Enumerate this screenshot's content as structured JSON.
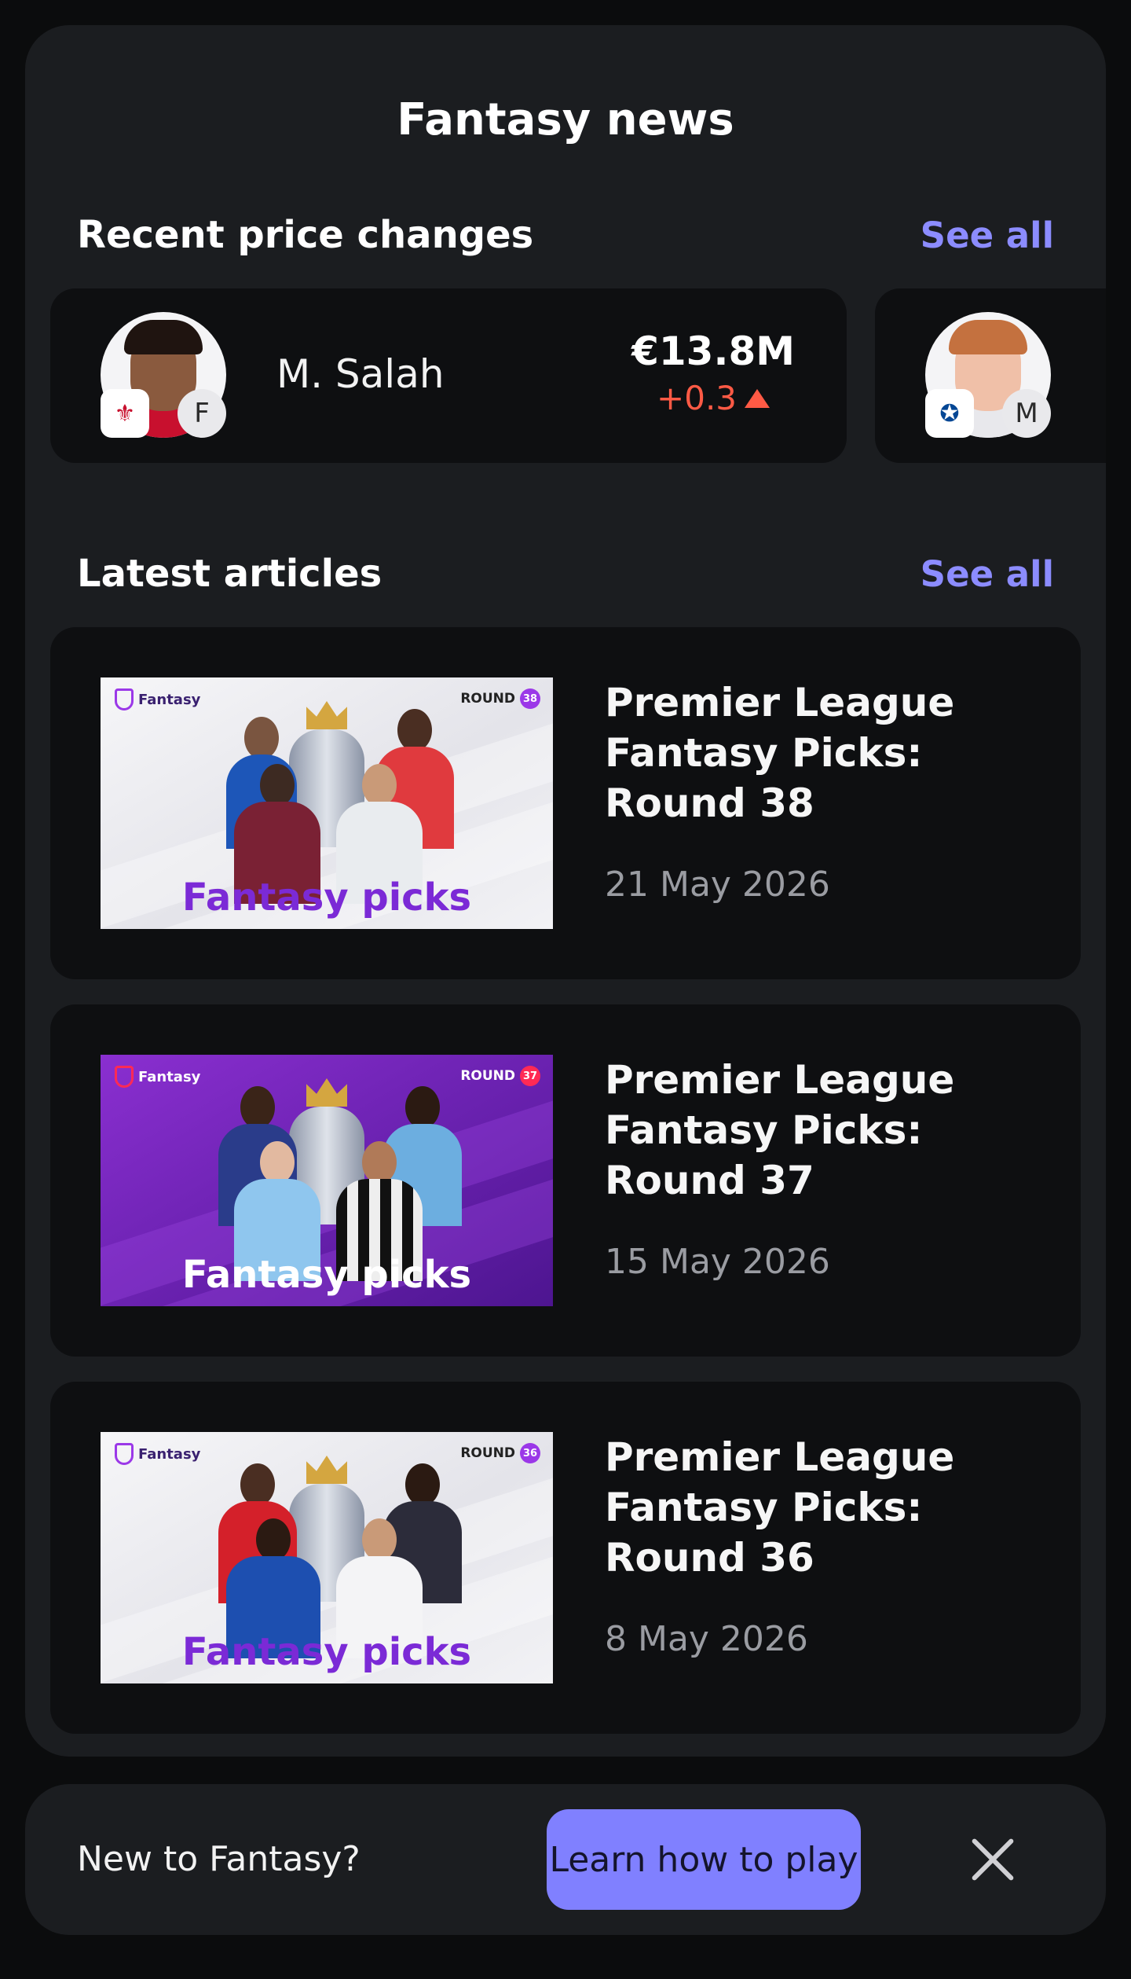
{
  "panel": {
    "title": "Fantasy news"
  },
  "price_changes": {
    "title": "Recent price changes",
    "see_all": "See all",
    "players": [
      {
        "name": "M. Salah",
        "position": "F",
        "team_badge": "liverpool-crest-icon",
        "price": "€13.8M",
        "change": "+0.3",
        "direction": "up",
        "change_color": "#ff5a45"
      },
      {
        "name": "",
        "position": "M",
        "team_badge": "chelsea-crest-icon"
      }
    ]
  },
  "articles": {
    "title": "Latest articles",
    "see_all": "See all",
    "items": [
      {
        "thumb_brand": "Fantasy",
        "thumb_round": "ROUND",
        "thumb_round_num": "38",
        "thumb_label": "Fantasy picks",
        "thumb_style": "light",
        "title": "Premier League Fantasy Picks: Round 38",
        "date": "21 May 2026"
      },
      {
        "thumb_brand": "Fantasy",
        "thumb_round": "ROUND",
        "thumb_round_num": "37",
        "thumb_label": "Fantasy picks",
        "thumb_style": "purple",
        "title": "Premier League Fantasy Picks: Round 37",
        "date": "15 May 2026"
      },
      {
        "thumb_brand": "Fantasy",
        "thumb_round": "ROUND",
        "thumb_round_num": "36",
        "thumb_label": "Fantasy picks",
        "thumb_style": "light",
        "title": "Premier League Fantasy Picks: Round 36",
        "date": "8 May 2026"
      }
    ]
  },
  "banner": {
    "text": "New to Fantasy?",
    "button": "Learn how to play",
    "close_icon": "close-icon"
  },
  "colors": {
    "accent": "#8080ff",
    "link": "#8c8cff",
    "price_up": "#ff5a45",
    "panel_bg": "#1b1d20",
    "card_bg": "#0e0f11"
  }
}
